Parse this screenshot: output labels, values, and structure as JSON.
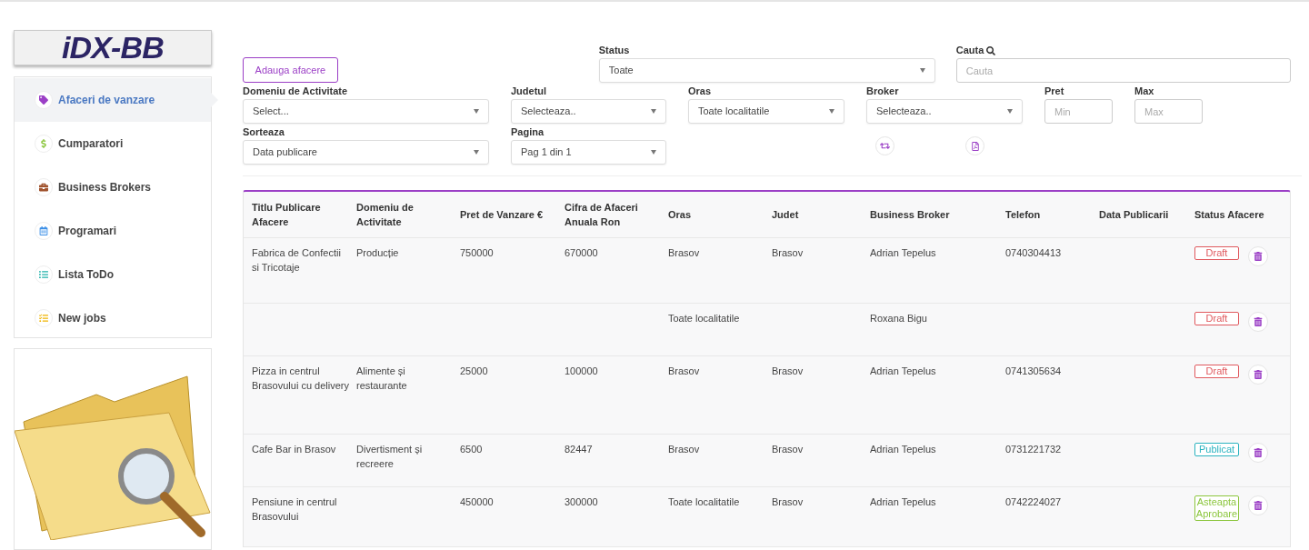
{
  "sidebar": {
    "logo": "iDX-BB",
    "items": [
      {
        "label": "Afaceri de vanzare",
        "kind": "tag",
        "selected": true
      },
      {
        "label": "Cumparatori",
        "kind": "dollar",
        "selected": false
      },
      {
        "label": "Business Brokers",
        "kind": "briefcase",
        "selected": false
      },
      {
        "label": "Programari",
        "kind": "calendar",
        "selected": false
      },
      {
        "label": "Lista ToDo",
        "kind": "list",
        "selected": false
      },
      {
        "label": "New jobs",
        "kind": "jobs",
        "selected": false
      }
    ]
  },
  "top": {
    "add_button": "Adauga afacere",
    "status": {
      "label": "Status",
      "value": "Toate"
    },
    "search": {
      "label": "Cauta",
      "placeholder": "Cauta"
    }
  },
  "filters": [
    {
      "label": "Domeniu de Activitate",
      "value": "Select..."
    },
    {
      "label": "Judetul",
      "value": "Selecteaza.."
    },
    {
      "label": "Oras",
      "value": "Toate localitatile"
    },
    {
      "label": "Broker",
      "value": "Selecteaza.."
    }
  ],
  "price": [
    {
      "label": "Pret",
      "placeholder": "Min"
    },
    {
      "label": "Max",
      "placeholder": "Max"
    }
  ],
  "sort": [
    {
      "label": "Sorteaza",
      "value": "Data publicare"
    },
    {
      "label": "Pagina",
      "value": "Pag 1 din 1"
    }
  ],
  "table": {
    "columns": [
      "Titlu Publicare Afacere",
      "Domeniu de Activitate",
      "Pret de Vanzare €",
      "Cifra de Afaceri Anuala Ron",
      "Oras",
      "Judet",
      "Business Broker",
      "Telefon",
      "Data Publicarii",
      "Status Afacere"
    ],
    "rows": [
      {
        "cells": [
          "Fabrica de Confectii si Tricotaje",
          "Producție",
          "750000",
          "670000",
          "Brasov",
          "Brasov",
          "Adrian Tepelus",
          "0740304413",
          null
        ],
        "status": {
          "label": "Draft",
          "color": "#e0595e"
        }
      },
      {
        "cells": [
          null,
          null,
          null,
          null,
          "Toate localitatile",
          null,
          "Roxana Bigu",
          null,
          null
        ],
        "status": {
          "label": "Draft",
          "color": "#e0595e"
        }
      },
      {
        "cells": [
          "Pizza in centrul Brasovului cu delivery",
          "Alimente și restaurante",
          "25000",
          "100000",
          "Brasov",
          "Brasov",
          "Adrian Tepelus",
          "0741305634",
          null
        ],
        "status": {
          "label": "Draft",
          "color": "#e0595e"
        }
      },
      {
        "cells": [
          "Cafe Bar in Brasov",
          "Divertisment și recreere",
          "6500",
          "82447",
          "Brasov",
          "Brasov",
          "Adrian Tepelus",
          "0731221732",
          null
        ],
        "status": {
          "label": "Publicat",
          "color": "#2bb3c0"
        }
      },
      {
        "cells": [
          "Pensiune in centrul Brasovului",
          null,
          "450000",
          "300000",
          "Toate localitatile",
          "Brasov",
          "Adrian Tepelus",
          "0742224027",
          null
        ],
        "status": {
          "label": "Asteapta Aprobare",
          "color": "#8cc63e"
        }
      }
    ]
  }
}
